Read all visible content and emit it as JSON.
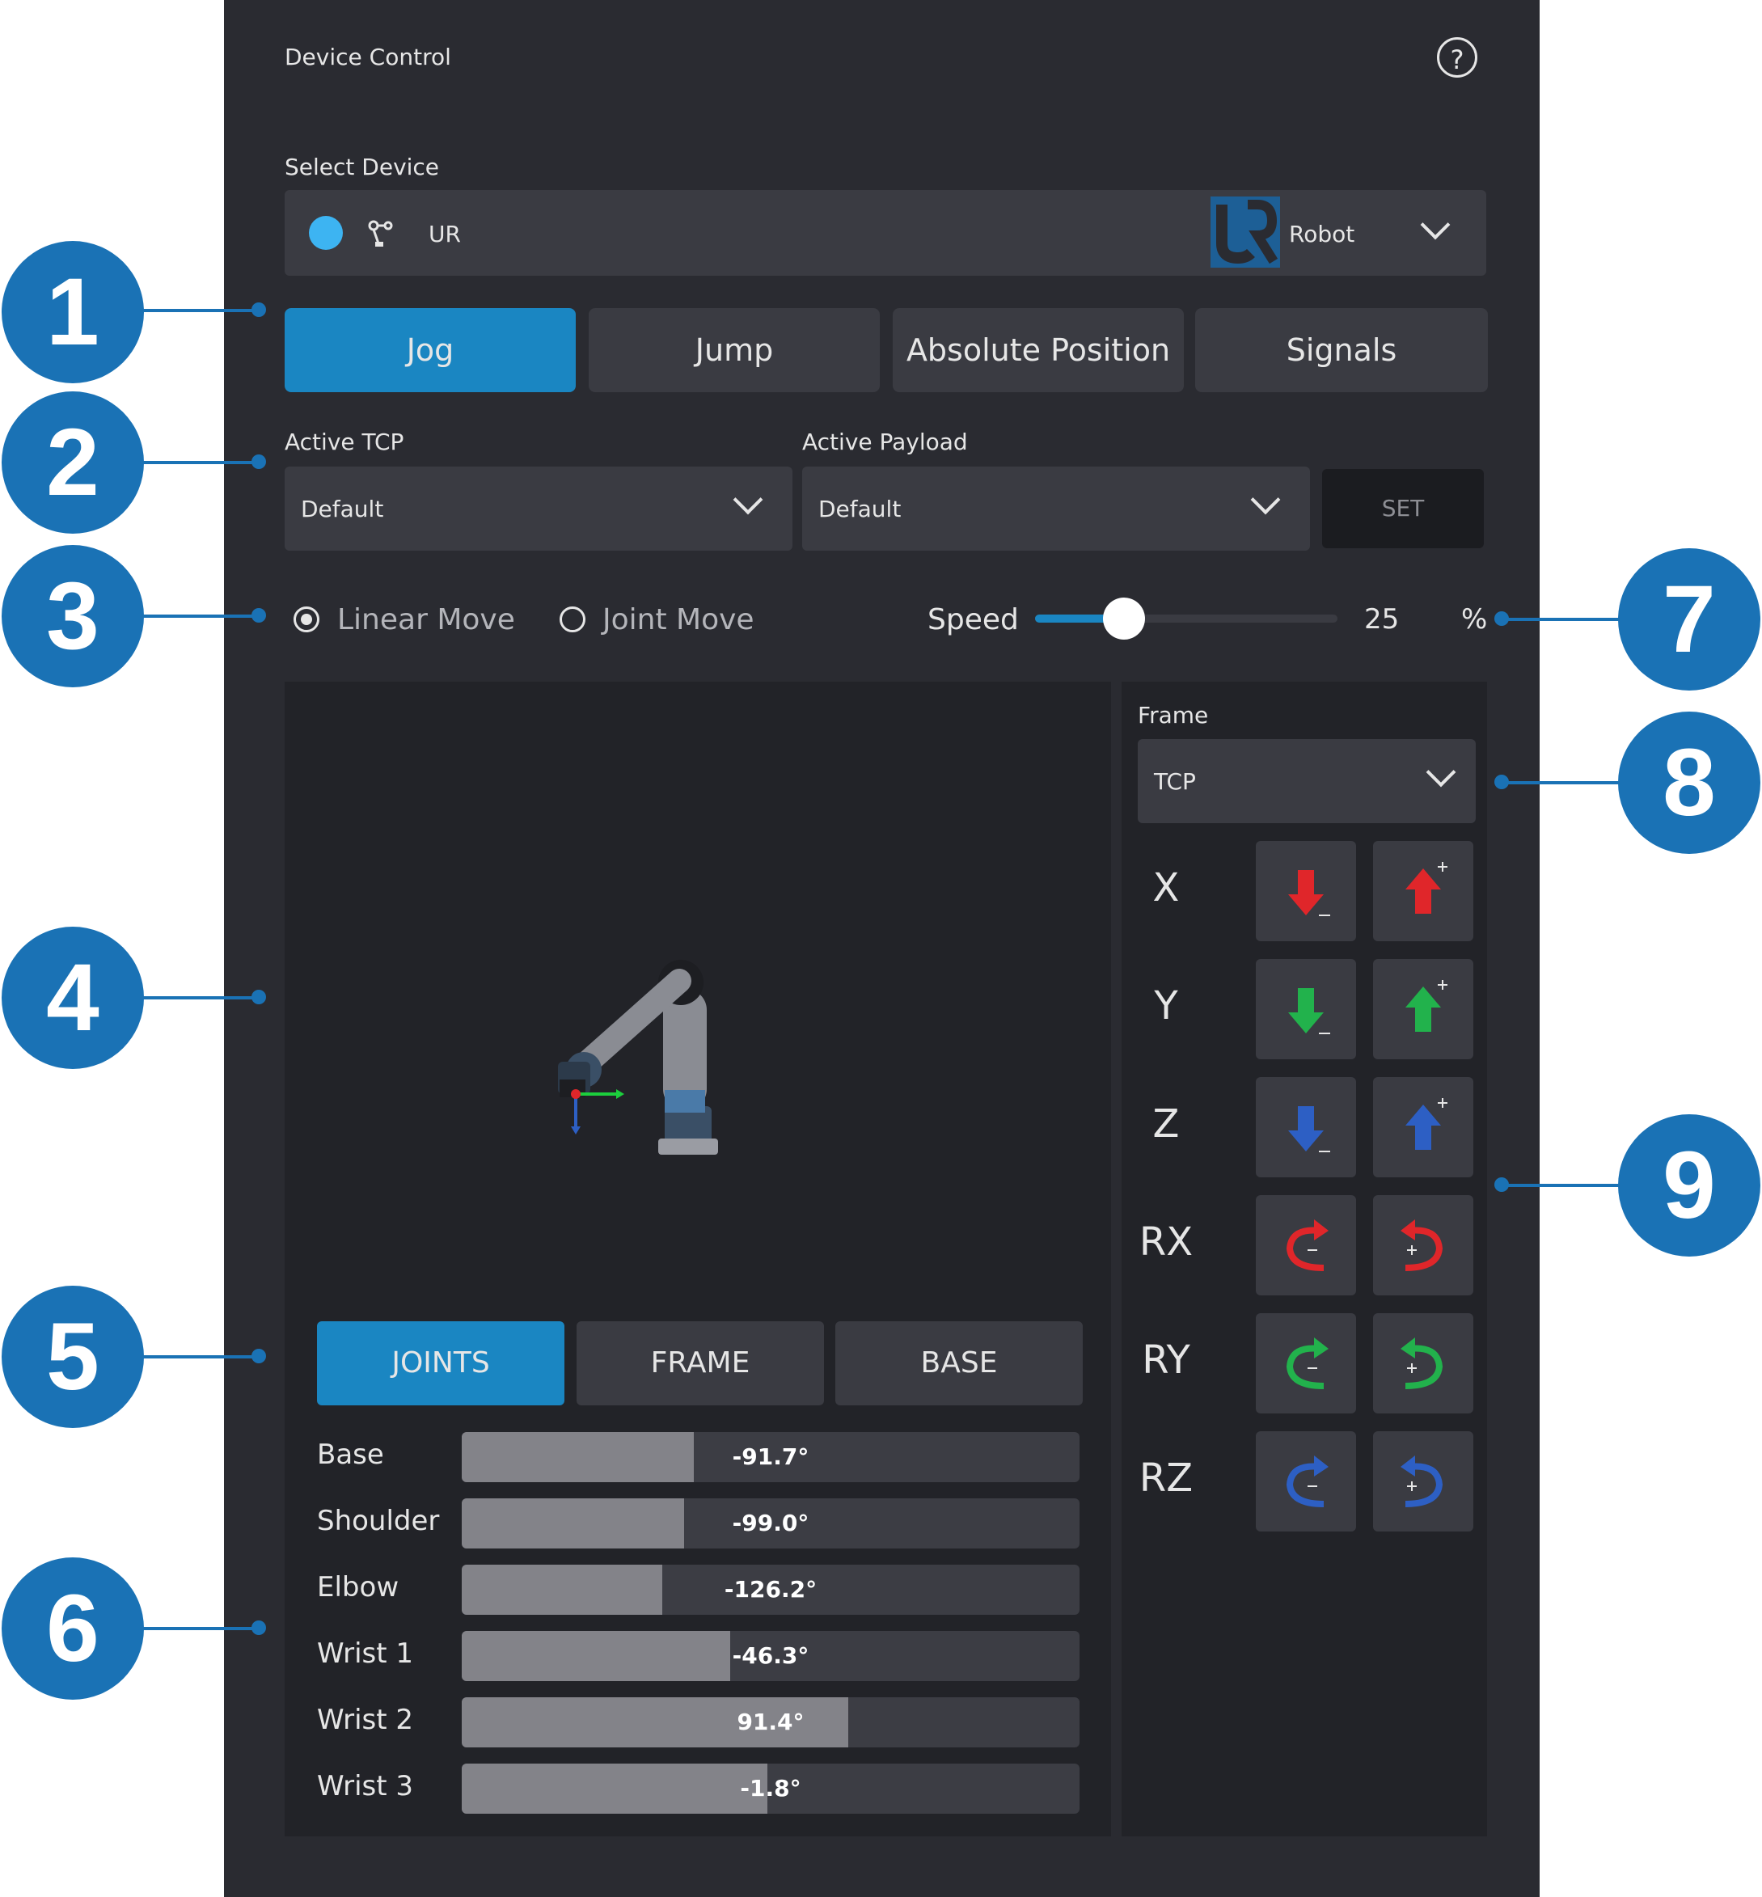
{
  "header": {
    "title": "Device Control",
    "help_icon": "?"
  },
  "device": {
    "label": "Select Device",
    "name": "UR",
    "type": "Robot",
    "status_color": "#3db4f2"
  },
  "tabs": [
    {
      "label": "Jog",
      "active": true
    },
    {
      "label": "Jump",
      "active": false
    },
    {
      "label": "Absolute Position",
      "active": false
    },
    {
      "label": "Signals",
      "active": false
    }
  ],
  "tcp": {
    "label": "Active TCP",
    "value": "Default"
  },
  "payload": {
    "label": "Active Payload",
    "value": "Default"
  },
  "set_button": "SET",
  "move_mode": {
    "linear": "Linear Move",
    "joint": "Joint Move",
    "selected": "linear"
  },
  "speed": {
    "label": "Speed",
    "value": "25",
    "unit": "%",
    "fraction": 0.25
  },
  "frame": {
    "label": "Frame",
    "value": "TCP"
  },
  "view_tabs": [
    {
      "label": "JOINTS",
      "active": true
    },
    {
      "label": "FRAME",
      "active": false
    },
    {
      "label": "BASE",
      "active": false
    }
  ],
  "joints": [
    {
      "name": "Base",
      "value": "-91.7°",
      "fraction": 0.375
    },
    {
      "name": "Shoulder",
      "value": "-99.0°",
      "fraction": 0.36
    },
    {
      "name": "Elbow",
      "value": "-126.2°",
      "fraction": 0.325
    },
    {
      "name": "Wrist 1",
      "value": "-46.3°",
      "fraction": 0.435
    },
    {
      "name": "Wrist 2",
      "value": "91.4°",
      "fraction": 0.625
    },
    {
      "name": "Wrist 3",
      "value": "-1.8°",
      "fraction": 0.495
    }
  ],
  "jog_axes": [
    {
      "axis": "X",
      "color": "#e0262a",
      "kind": "linear"
    },
    {
      "axis": "Y",
      "color": "#22b24c",
      "kind": "linear"
    },
    {
      "axis": "Z",
      "color": "#2d5fc4",
      "kind": "linear"
    },
    {
      "axis": "RX",
      "color": "#e0262a",
      "kind": "rotary"
    },
    {
      "axis": "RY",
      "color": "#22b24c",
      "kind": "rotary"
    },
    {
      "axis": "RZ",
      "color": "#2d5fc4",
      "kind": "rotary"
    }
  ],
  "callouts": [
    "1",
    "2",
    "3",
    "4",
    "5",
    "6",
    "7",
    "8",
    "9"
  ]
}
